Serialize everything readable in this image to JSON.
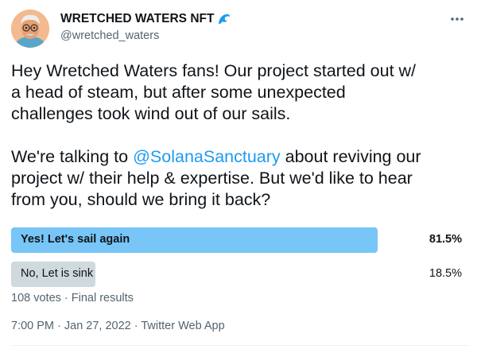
{
  "author": {
    "display_name": "WRETCHED WATERS NFT",
    "handle": "@wretched_waters",
    "name_emoji_icon": "wave-icon",
    "avatar_icon": "avatar"
  },
  "tweet": {
    "text_line1": "Hey Wretched Waters fans! Our project started out w/\na head of steam, but after some unexpected\nchallenges took wind out of our sails.\n\nWe're talking to ",
    "mention": "@SolanaSanctuary",
    "text_line2": " about reviving our\nproject w/ their help & expertise. But we'd like to hear\nfrom you, should we bring it back?"
  },
  "poll": {
    "options": [
      {
        "label": "Yes! Let's sail again",
        "percent_text": "81.5%",
        "fraction": 0.815
      },
      {
        "label": "No, Let is sink",
        "percent_text": "18.5%",
        "fraction": 0.185
      }
    ],
    "meta": "108 votes · Final results"
  },
  "footer": {
    "timestamp": "7:00 PM · Jan 27, 2022 · Twitter Web App"
  },
  "colors": {
    "accent": "#1d9bf0",
    "winner_bar": "#77c6f7",
    "loser_bar": "#cfd9de"
  }
}
